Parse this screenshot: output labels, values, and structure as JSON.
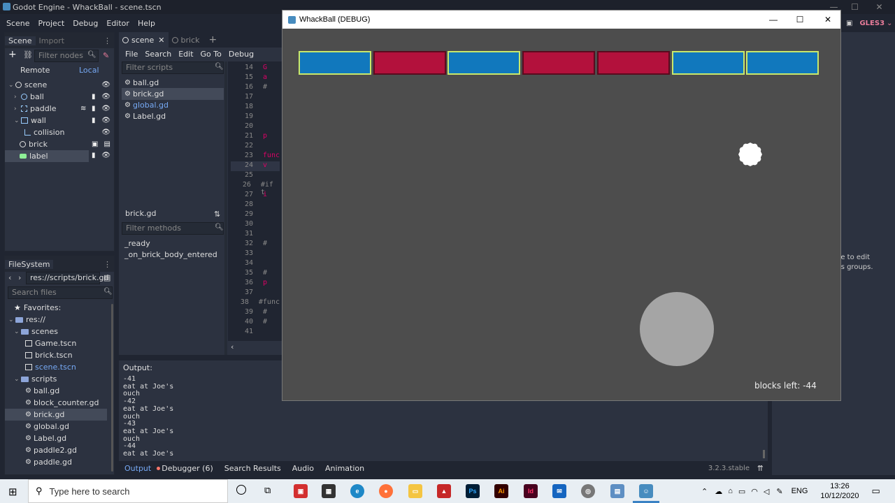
{
  "window_title": "Godot Engine - WhackBall - scene.tscn",
  "menu": [
    "Scene",
    "Project",
    "Debug",
    "Editor",
    "Help"
  ],
  "renderer": "GLES3",
  "scene_dock": {
    "tabs": [
      "Scene",
      "Import"
    ],
    "filter_placeholder": "Filter nodes",
    "remote_label": "Remote",
    "local_label": "Local",
    "nodes": [
      {
        "label": "scene",
        "icon": "node-icon"
      },
      {
        "label": "ball",
        "icon": "globe-icon"
      },
      {
        "label": "paddle",
        "icon": "sprite-icon"
      },
      {
        "label": "wall",
        "icon": "scene-icon"
      },
      {
        "label": "collision",
        "icon": "collision-icon"
      },
      {
        "label": "brick",
        "icon": "node-icon"
      },
      {
        "label": "label",
        "icon": "label-icon"
      }
    ]
  },
  "filesystem_dock": {
    "title": "FileSystem",
    "path": "res://scripts/brick.gd",
    "search_placeholder": "Search files",
    "favorites_label": "Favorites:",
    "root_label": "res://",
    "folders": {
      "scenes": {
        "label": "scenes",
        "files": [
          "Game.tscn",
          "brick.tscn",
          "scene.tscn"
        ]
      },
      "scripts": {
        "label": "scripts",
        "files": [
          "ball.gd",
          "block_counter.gd",
          "brick.gd",
          "global.gd",
          "Label.gd",
          "paddle2.gd",
          "paddle.gd"
        ]
      }
    }
  },
  "editor_tabs": [
    "scene",
    "brick"
  ],
  "script_menu": [
    "File",
    "Search",
    "Edit",
    "Go To",
    "Debug"
  ],
  "scripts_panel": {
    "filter_placeholder": "Filter scripts",
    "scripts": [
      "ball.gd",
      "brick.gd",
      "global.gd",
      "Label.gd"
    ],
    "current": "brick.gd",
    "methods_placeholder": "Filter methods",
    "methods": [
      "_ready",
      "_on_brick_body_entered"
    ]
  },
  "code": {
    "lines": [
      {
        "num": "14",
        "text": "G"
      },
      {
        "num": "15",
        "text": "a"
      },
      {
        "num": "16",
        "text": "#"
      },
      {
        "num": "17",
        "text": ""
      },
      {
        "num": "18",
        "text": ""
      },
      {
        "num": "19",
        "text": ""
      },
      {
        "num": "20",
        "text": ""
      },
      {
        "num": "21",
        "text": "p"
      },
      {
        "num": "22",
        "text": ""
      },
      {
        "num": "23",
        "text": "func"
      },
      {
        "num": "24",
        "text": "v"
      },
      {
        "num": "25",
        "text": ""
      },
      {
        "num": "26",
        "text": "#if t"
      },
      {
        "num": "27",
        "text": "i"
      },
      {
        "num": "28",
        "text": ""
      },
      {
        "num": "29",
        "text": ""
      },
      {
        "num": "30",
        "text": ""
      },
      {
        "num": "31",
        "text": ""
      },
      {
        "num": "32",
        "text": "#"
      },
      {
        "num": "33",
        "text": ""
      },
      {
        "num": "34",
        "text": ""
      },
      {
        "num": "35",
        "text": "#"
      },
      {
        "num": "36",
        "text": "p"
      },
      {
        "num": "37",
        "text": ""
      },
      {
        "num": "38",
        "text": "#func"
      },
      {
        "num": "39",
        "text": "#"
      },
      {
        "num": "40",
        "text": "#"
      },
      {
        "num": "41",
        "text": ""
      }
    ]
  },
  "output": {
    "title": "Output:",
    "lines": [
      "-41",
      "eat at Joe's",
      "ouch",
      "-42",
      "eat at Joe's",
      "ouch",
      "-43",
      "eat at Joe's",
      "ouch",
      "-44",
      "eat at Joe's"
    ]
  },
  "bottom_tabs": [
    "Output",
    "Debugger (6)",
    "Search Results",
    "Audio",
    "Animation"
  ],
  "version": "3.2.3.stable",
  "inspector_hint": "de to edit its groups.",
  "game": {
    "title": "WhackBall (DEBUG)",
    "bricks": [
      {
        "color": "#1178bd"
      },
      {
        "color": "#b3113c"
      },
      {
        "color": "#1178bd"
      },
      {
        "color": "#b3113c"
      },
      {
        "color": "#b3113c"
      },
      {
        "color": "#1178bd"
      },
      {
        "color": "#1178bd"
      }
    ],
    "blocks_label": "blocks left: -44"
  },
  "taskbar": {
    "search_placeholder": "Type here to search",
    "lang": "ENG",
    "time": "13:26",
    "date": "10/12/2020",
    "apps": [
      "Ps",
      "Ai",
      "Id"
    ]
  }
}
